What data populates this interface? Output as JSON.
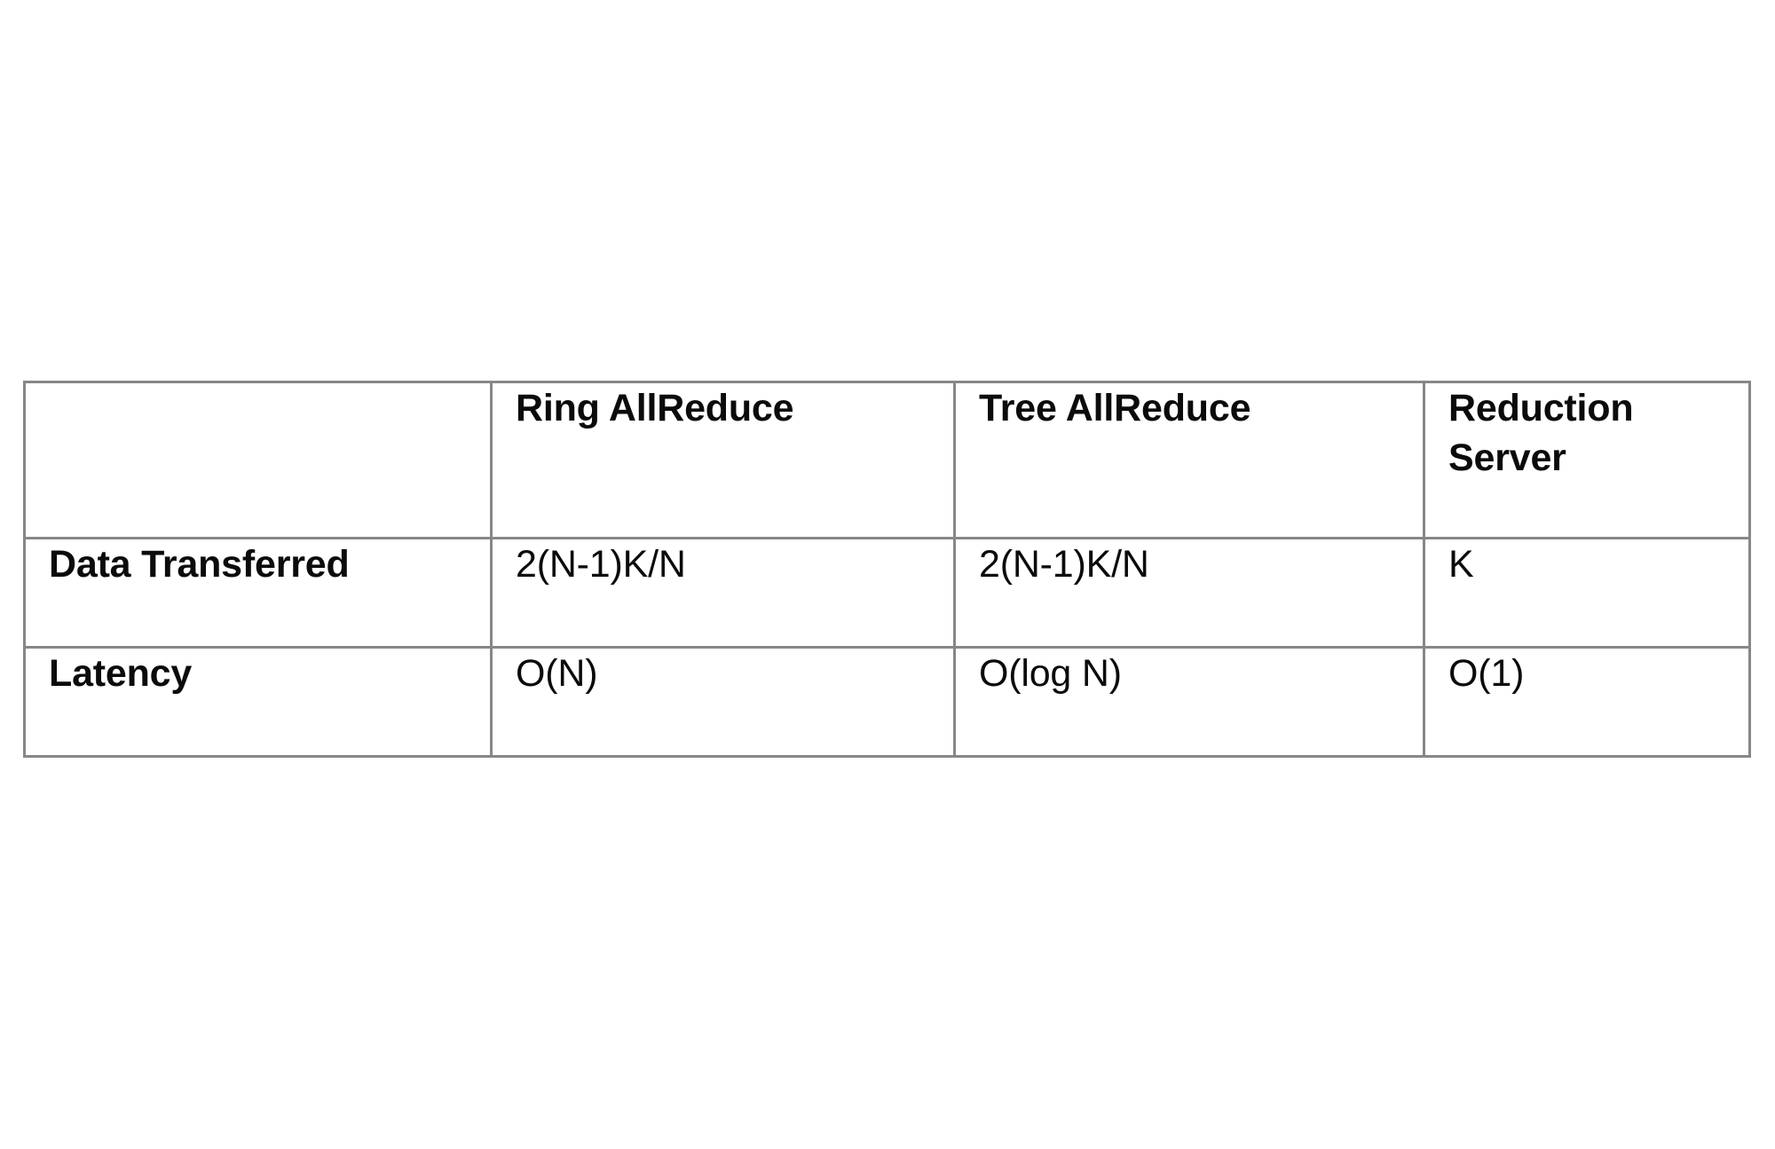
{
  "table": {
    "columns": [
      {
        "key": "label",
        "header": ""
      },
      {
        "key": "ring",
        "header": "Ring AllReduce"
      },
      {
        "key": "tree",
        "header": "Tree AllReduce"
      },
      {
        "key": "reduction_server",
        "header": "Reduction Server"
      }
    ],
    "rows": [
      {
        "label": "Data Transferred",
        "ring": "2(N-1)K/N",
        "tree": "2(N-1)K/N",
        "reduction_server": "K"
      },
      {
        "label": "Latency",
        "ring": "O(N)",
        "tree": "O(log N)",
        "reduction_server": "O(1)"
      }
    ]
  },
  "style": {
    "border_color": "#878787",
    "text_color": "#0b0b0b",
    "background": "#ffffff"
  }
}
